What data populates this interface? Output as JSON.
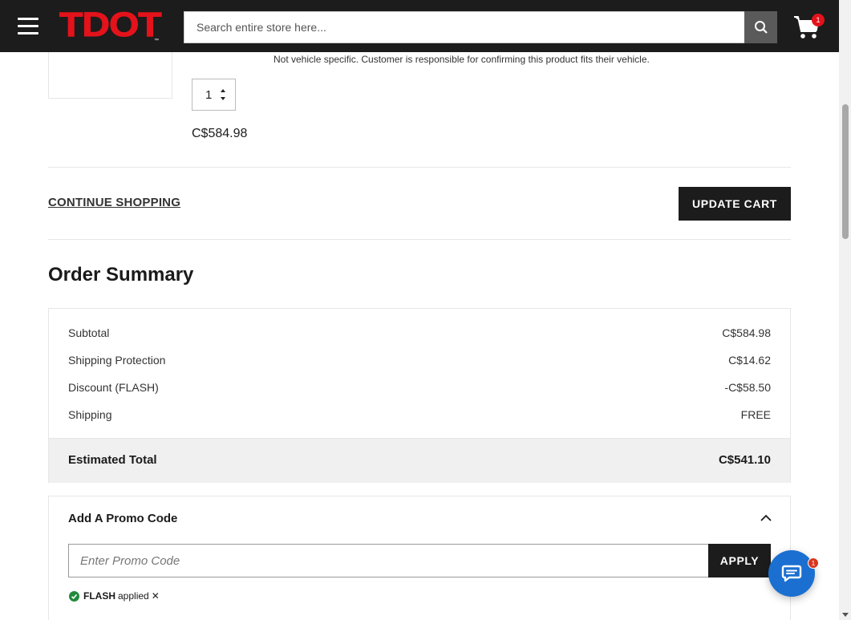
{
  "header": {
    "logo_text": "TDOT",
    "logo_tm": "™",
    "search_placeholder": "Search entire store here...",
    "cart_count": "1",
    "brand_color": "#e3121b"
  },
  "product": {
    "fitment_note": "Not vehicle specific. Customer is responsible for confirming this product fits their vehicle.",
    "quantity": "1",
    "price": "C$584.98"
  },
  "actions": {
    "continue_shopping": "CONTINUE SHOPPING",
    "update_cart": "UPDATE CART"
  },
  "summary": {
    "title": "Order Summary",
    "rows": [
      {
        "label": "Subtotal",
        "value": "C$584.98"
      },
      {
        "label": "Shipping Protection",
        "value": "C$14.62"
      },
      {
        "label": "Discount (FLASH)",
        "value": "-C$58.50"
      },
      {
        "label": "Shipping",
        "value": "FREE"
      }
    ],
    "total_label": "Estimated Total",
    "total_value": "C$541.10"
  },
  "promo": {
    "title": "Add A Promo Code",
    "placeholder": "Enter Promo Code",
    "apply_label": "APPLY",
    "applied_code": "FLASH",
    "applied_text": "applied",
    "remove_symbol": "✕"
  },
  "chat": {
    "badge_count": "1",
    "color": "#1b6fd0"
  },
  "icons": {
    "menu": "hamburger-menu-icon",
    "search": "search-icon",
    "cart": "cart-icon",
    "chevron": "chevron-up-icon",
    "check": "check-circle-icon",
    "chat": "chat-bubble-icon"
  }
}
